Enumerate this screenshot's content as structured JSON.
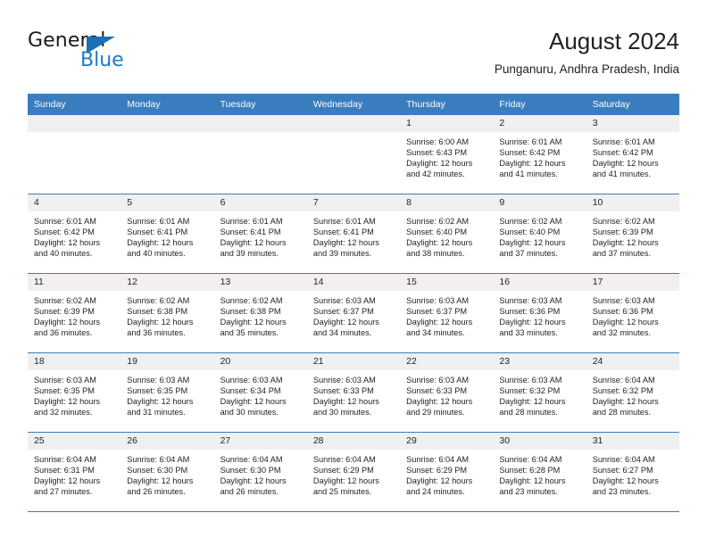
{
  "logo": {
    "word_top": "General",
    "word_bottom": "Blue",
    "triangle_color": "#1d6fb8",
    "blue_text_color": "#1d7cc4"
  },
  "header": {
    "title": "August 2024",
    "location": "Punganuru, Andhra Pradesh, India"
  },
  "theme": {
    "header_row_bg": "#3a7dbf",
    "header_row_text": "#ffffff",
    "daynum_band_bg": "#f0f0f0",
    "cell_bg": "#ffffff",
    "row_divider": "#3a7dbf",
    "text": "#231f20"
  },
  "weekday_headers": [
    "Sunday",
    "Monday",
    "Tuesday",
    "Wednesday",
    "Thursday",
    "Friday",
    "Saturday"
  ],
  "weeks": [
    [
      {
        "day": "",
        "empty": true,
        "lines": []
      },
      {
        "day": "",
        "empty": true,
        "lines": []
      },
      {
        "day": "",
        "empty": true,
        "lines": []
      },
      {
        "day": "",
        "empty": true,
        "lines": []
      },
      {
        "day": "1",
        "empty": false,
        "lines": [
          "Sunrise: 6:00 AM",
          "Sunset: 6:43 PM",
          "Daylight: 12 hours",
          "and 42 minutes."
        ]
      },
      {
        "day": "2",
        "empty": false,
        "lines": [
          "Sunrise: 6:01 AM",
          "Sunset: 6:42 PM",
          "Daylight: 12 hours",
          "and 41 minutes."
        ]
      },
      {
        "day": "3",
        "empty": false,
        "lines": [
          "Sunrise: 6:01 AM",
          "Sunset: 6:42 PM",
          "Daylight: 12 hours",
          "and 41 minutes."
        ]
      }
    ],
    [
      {
        "day": "4",
        "empty": false,
        "lines": [
          "Sunrise: 6:01 AM",
          "Sunset: 6:42 PM",
          "Daylight: 12 hours",
          "and 40 minutes."
        ]
      },
      {
        "day": "5",
        "empty": false,
        "lines": [
          "Sunrise: 6:01 AM",
          "Sunset: 6:41 PM",
          "Daylight: 12 hours",
          "and 40 minutes."
        ]
      },
      {
        "day": "6",
        "empty": false,
        "lines": [
          "Sunrise: 6:01 AM",
          "Sunset: 6:41 PM",
          "Daylight: 12 hours",
          "and 39 minutes."
        ]
      },
      {
        "day": "7",
        "empty": false,
        "lines": [
          "Sunrise: 6:01 AM",
          "Sunset: 6:41 PM",
          "Daylight: 12 hours",
          "and 39 minutes."
        ]
      },
      {
        "day": "8",
        "empty": false,
        "lines": [
          "Sunrise: 6:02 AM",
          "Sunset: 6:40 PM",
          "Daylight: 12 hours",
          "and 38 minutes."
        ]
      },
      {
        "day": "9",
        "empty": false,
        "lines": [
          "Sunrise: 6:02 AM",
          "Sunset: 6:40 PM",
          "Daylight: 12 hours",
          "and 37 minutes."
        ]
      },
      {
        "day": "10",
        "empty": false,
        "lines": [
          "Sunrise: 6:02 AM",
          "Sunset: 6:39 PM",
          "Daylight: 12 hours",
          "and 37 minutes."
        ]
      }
    ],
    [
      {
        "day": "11",
        "empty": false,
        "lines": [
          "Sunrise: 6:02 AM",
          "Sunset: 6:39 PM",
          "Daylight: 12 hours",
          "and 36 minutes."
        ]
      },
      {
        "day": "12",
        "empty": false,
        "lines": [
          "Sunrise: 6:02 AM",
          "Sunset: 6:38 PM",
          "Daylight: 12 hours",
          "and 36 minutes."
        ]
      },
      {
        "day": "13",
        "empty": false,
        "lines": [
          "Sunrise: 6:02 AM",
          "Sunset: 6:38 PM",
          "Daylight: 12 hours",
          "and 35 minutes."
        ]
      },
      {
        "day": "14",
        "empty": false,
        "lines": [
          "Sunrise: 6:03 AM",
          "Sunset: 6:37 PM",
          "Daylight: 12 hours",
          "and 34 minutes."
        ]
      },
      {
        "day": "15",
        "empty": false,
        "lines": [
          "Sunrise: 6:03 AM",
          "Sunset: 6:37 PM",
          "Daylight: 12 hours",
          "and 34 minutes."
        ]
      },
      {
        "day": "16",
        "empty": false,
        "lines": [
          "Sunrise: 6:03 AM",
          "Sunset: 6:36 PM",
          "Daylight: 12 hours",
          "and 33 minutes."
        ]
      },
      {
        "day": "17",
        "empty": false,
        "lines": [
          "Sunrise: 6:03 AM",
          "Sunset: 6:36 PM",
          "Daylight: 12 hours",
          "and 32 minutes."
        ]
      }
    ],
    [
      {
        "day": "18",
        "empty": false,
        "lines": [
          "Sunrise: 6:03 AM",
          "Sunset: 6:35 PM",
          "Daylight: 12 hours",
          "and 32 minutes."
        ]
      },
      {
        "day": "19",
        "empty": false,
        "lines": [
          "Sunrise: 6:03 AM",
          "Sunset: 6:35 PM",
          "Daylight: 12 hours",
          "and 31 minutes."
        ]
      },
      {
        "day": "20",
        "empty": false,
        "lines": [
          "Sunrise: 6:03 AM",
          "Sunset: 6:34 PM",
          "Daylight: 12 hours",
          "and 30 minutes."
        ]
      },
      {
        "day": "21",
        "empty": false,
        "lines": [
          "Sunrise: 6:03 AM",
          "Sunset: 6:33 PM",
          "Daylight: 12 hours",
          "and 30 minutes."
        ]
      },
      {
        "day": "22",
        "empty": false,
        "lines": [
          "Sunrise: 6:03 AM",
          "Sunset: 6:33 PM",
          "Daylight: 12 hours",
          "and 29 minutes."
        ]
      },
      {
        "day": "23",
        "empty": false,
        "lines": [
          "Sunrise: 6:03 AM",
          "Sunset: 6:32 PM",
          "Daylight: 12 hours",
          "and 28 minutes."
        ]
      },
      {
        "day": "24",
        "empty": false,
        "lines": [
          "Sunrise: 6:04 AM",
          "Sunset: 6:32 PM",
          "Daylight: 12 hours",
          "and 28 minutes."
        ]
      }
    ],
    [
      {
        "day": "25",
        "empty": false,
        "lines": [
          "Sunrise: 6:04 AM",
          "Sunset: 6:31 PM",
          "Daylight: 12 hours",
          "and 27 minutes."
        ]
      },
      {
        "day": "26",
        "empty": false,
        "lines": [
          "Sunrise: 6:04 AM",
          "Sunset: 6:30 PM",
          "Daylight: 12 hours",
          "and 26 minutes."
        ]
      },
      {
        "day": "27",
        "empty": false,
        "lines": [
          "Sunrise: 6:04 AM",
          "Sunset: 6:30 PM",
          "Daylight: 12 hours",
          "and 26 minutes."
        ]
      },
      {
        "day": "28",
        "empty": false,
        "lines": [
          "Sunrise: 6:04 AM",
          "Sunset: 6:29 PM",
          "Daylight: 12 hours",
          "and 25 minutes."
        ]
      },
      {
        "day": "29",
        "empty": false,
        "lines": [
          "Sunrise: 6:04 AM",
          "Sunset: 6:29 PM",
          "Daylight: 12 hours",
          "and 24 minutes."
        ]
      },
      {
        "day": "30",
        "empty": false,
        "lines": [
          "Sunrise: 6:04 AM",
          "Sunset: 6:28 PM",
          "Daylight: 12 hours",
          "and 23 minutes."
        ]
      },
      {
        "day": "31",
        "empty": false,
        "lines": [
          "Sunrise: 6:04 AM",
          "Sunset: 6:27 PM",
          "Daylight: 12 hours",
          "and 23 minutes."
        ]
      }
    ]
  ]
}
